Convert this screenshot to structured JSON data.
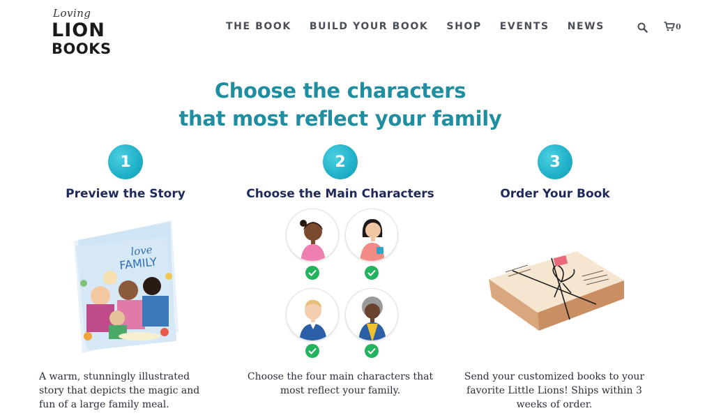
{
  "brand": {
    "script": "Loving",
    "line1": "LION",
    "line2": "BOOKS"
  },
  "nav": {
    "items": [
      "THE BOOK",
      "BUILD YOUR BOOK",
      "SHOP",
      "EVENTS",
      "NEWS"
    ],
    "cart_count": "0"
  },
  "headline": {
    "line1": "Choose the characters",
    "line2": "that most reflect your family"
  },
  "steps": [
    {
      "number": "1",
      "title": "Preview the Story",
      "desc_lines": [
        "A warm, stunningly illustrated",
        "story that depicts the magic and",
        "fun of a large family meal."
      ]
    },
    {
      "number": "2",
      "title": "Choose the Main Characters",
      "desc_lines": [
        "Choose the four main characters that",
        "most reflect your family."
      ]
    },
    {
      "number": "3",
      "title": "Order Your Book",
      "desc_lines": [
        "Send your customized books to your",
        "favorite Little Lions! Ships within 3",
        "weeks of order."
      ]
    }
  ],
  "book_cover": {
    "title_script": "love",
    "title_main": "FAMILY"
  },
  "colors": {
    "accent": "#1f8ea0",
    "badge": "#1fb0c8",
    "heading_dark": "#1f2a5a",
    "check_green": "#22b35e"
  }
}
